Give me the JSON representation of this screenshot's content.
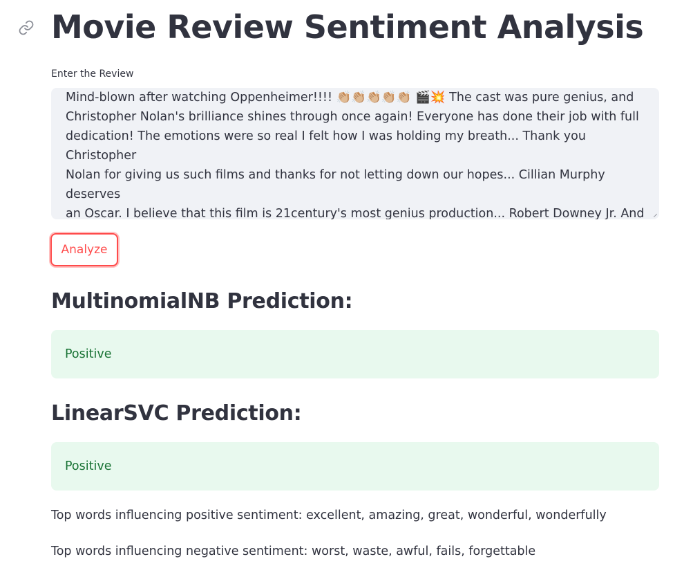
{
  "header": {
    "title": "Movie Review Sentiment Analysis",
    "anchor_icon": "link-icon"
  },
  "review": {
    "label": "Enter the Review",
    "value": "Mind-blown after watching Oppenheimer!!!! 👏🏼👏🏼👏🏼👏🏼👏🏼 🎬💥 The cast was pure genius, and\nChristopher Nolan's brilliance shines through once again! Everyone has done their job with full\ndedication! The emotions were so real I felt how I was holding my breath... Thank you Christopher\nNolan for giving us such films and thanks for not letting down our hopes... Cillian Murphy deserves\nan Oscar. I believe that this film is 21century's most genius production... Robert Downey Jr. And\nEmily Blunt did their jobs amazingly... I try not to spoil people here but I guarantee amazing\nemotions, beautiful scenes and genius performance."
  },
  "actions": {
    "analyze_label": "Analyze"
  },
  "results": {
    "multinomialnb": {
      "heading": "MultinomialNB Prediction:",
      "prediction": "Positive"
    },
    "linearsvc": {
      "heading": "LinearSVC Prediction:",
      "prediction": "Positive"
    }
  },
  "top_words": {
    "positive": "Top words influencing positive sentiment: excellent, amazing, great, wonderful, wonderfully",
    "negative": "Top words influencing negative sentiment: worst, waste, awful, fails, forgettable"
  },
  "colors": {
    "accent": "#ff4b4b",
    "success_bg": "#e8f9ee",
    "success_text": "#177233",
    "input_bg": "#f0f2f6",
    "text": "#31333f"
  }
}
